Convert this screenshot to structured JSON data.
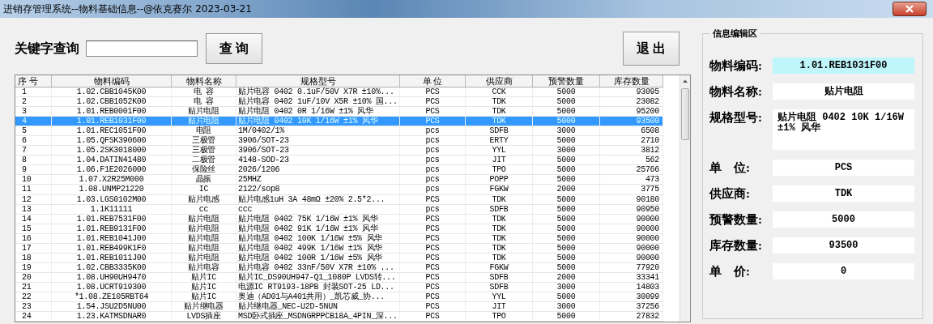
{
  "window": {
    "title": "进销存管理系统--物料基础信息--@依克赛尔 2023-03-21"
  },
  "search": {
    "label": "关键字查询",
    "button": "查 询"
  },
  "exit_button": "退 出",
  "table": {
    "columns": [
      "序 号",
      "物料编码",
      "物料名称",
      "规格型号",
      "单 位",
      "供应商",
      "预警数量",
      "库存数量"
    ],
    "rows": [
      {
        "cells": [
          "1",
          "1.02.CBB1045K00",
          "电 容",
          "贴片电容 0402 0.1uF/50V X7R ±10%...",
          "PCS",
          "CCK",
          "5000",
          "93095"
        ],
        "selected": false
      },
      {
        "cells": [
          "2",
          "1.02.CBB1052K00",
          "电 容",
          "贴片电容 0402 1uF/10V X5R ±10% 国...",
          "PCS",
          "TDK",
          "5000",
          "23082"
        ],
        "selected": false
      },
      {
        "cells": [
          "3",
          "1.01.REB0001F00",
          "贴片电阻",
          "贴片电阻 0402 0R 1/16W ±1% 风华",
          "PCS",
          "TDK",
          "5000",
          "95200"
        ],
        "selected": false
      },
      {
        "cells": [
          "4",
          "1.01.REB1031F00",
          "贴片电阻",
          "贴片电阻 0402 10K 1/16W ±1% 风华",
          "PCS",
          "TDK",
          "5000",
          "93500"
        ],
        "selected": true
      },
      {
        "cells": [
          "5",
          "1.01.REC1051F00",
          "电阻",
          "1M/0402/1%",
          "pcs",
          "SDFB",
          "3000",
          "6508"
        ],
        "selected": false
      },
      {
        "cells": [
          "6",
          "1.05.QFSK390600",
          "三极管",
          "3906/SOT-23",
          "pcs",
          "ERTY",
          "5000",
          "2710"
        ],
        "selected": false
      },
      {
        "cells": [
          "7",
          "1.05.2SK3018000",
          "三极管",
          "3906/SOT-23",
          "pcs",
          "YYL",
          "3000",
          "3812"
        ],
        "selected": false
      },
      {
        "cells": [
          "8",
          "1.04.DATIN41480",
          "二极管",
          "4148-SOD-23",
          "pcs",
          "JIT",
          "5000",
          "562"
        ],
        "selected": false
      },
      {
        "cells": [
          "9",
          "1.06.F1E2026000",
          "保险丝",
          "2026/1206",
          "pcs",
          "TPO",
          "5000",
          "25766"
        ],
        "selected": false
      },
      {
        "cells": [
          "10",
          "1.07.X2R25M000",
          "晶振",
          "25MHZ",
          "pcs",
          "POPP",
          "5000",
          "473"
        ],
        "selected": false
      },
      {
        "cells": [
          "11",
          "1.08.UNMP21220",
          "IC",
          "2122/sop8",
          "pcs",
          "FGKW",
          "2000",
          "3775"
        ],
        "selected": false
      },
      {
        "cells": [
          "12",
          "1.03.LGS0102M00",
          "贴片电感",
          "贴片电感1uH 3A 48mΩ ±20% 2.5*2...",
          "PCS",
          "TDK",
          "5000",
          "90180"
        ],
        "selected": false
      },
      {
        "cells": [
          "13",
          "1.1K11111",
          "cc",
          "ccc",
          "pcs",
          "SDFB",
          "5000",
          "90950"
        ],
        "selected": false
      },
      {
        "cells": [
          "14",
          "1.01.REB7531F00",
          "贴片电阻",
          "贴片电阻 0402 75K 1/16W ±1% 风华",
          "PCS",
          "TDK",
          "5000",
          "90000"
        ],
        "selected": false
      },
      {
        "cells": [
          "15",
          "1.01.REB9131F00",
          "贴片电阻",
          "贴片电阻 0402 91K 1/16W ±1% 风华",
          "PCS",
          "TDK",
          "5000",
          "90000"
        ],
        "selected": false
      },
      {
        "cells": [
          "16",
          "1.01.REB1041J00",
          "贴片电阻",
          "贴片电阻 0402 100K 1/16W ±5% 风华",
          "PCS",
          "TDK",
          "5000",
          "90000"
        ],
        "selected": false
      },
      {
        "cells": [
          "17",
          "1.01.REB499K1F0",
          "贴片电阻",
          "贴片电阻 0402 499K 1/16W ±1% 风华",
          "PCS",
          "TDK",
          "5000",
          "90000"
        ],
        "selected": false
      },
      {
        "cells": [
          "18",
          "1.01.REB1011J00",
          "贴片电阻",
          "贴片电阻 0402 100R 1/16W ±5% 风华",
          "PCS",
          "TDK",
          "5000",
          "90000"
        ],
        "selected": false
      },
      {
        "cells": [
          "19",
          "1.02.CBB3335K00",
          "贴片电容",
          "贴片电容 0402 33nF/50V X7R ±10% ...",
          "PCS",
          "FGKW",
          "5000",
          "77920"
        ],
        "selected": false
      },
      {
        "cells": [
          "20",
          "1.08.UH90UH9470",
          "贴片IC",
          "贴片IC_DS90UH947-Q1_1080P LVDS转...",
          "PCS",
          "SDFB",
          "2000",
          "33341"
        ],
        "selected": false
      },
      {
        "cells": [
          "21",
          "1.08.UCRT919300",
          "贴片IC",
          "电源IC RT9193-18PB 封装SOT-25 LD...",
          "PCS",
          "SDFB",
          "3000",
          "14803"
        ],
        "selected": false
      },
      {
        "cells": [
          "22",
          "*1.08.ZE105RBT64",
          "贴片IC",
          "奥迪（AD01与A401共用）_凯芯威_协...",
          "PCS",
          "YYL",
          "5000",
          "30099"
        ],
        "selected": false
      },
      {
        "cells": [
          "23",
          "1.54.JSU2D5NU00",
          "贴片继电器",
          "贴片继电器_NEC-U2D-5NUN",
          "PCS",
          "JIT",
          "3000",
          "37256"
        ],
        "selected": false
      },
      {
        "cells": [
          "24",
          "1.23.KATMSDNAR0",
          "LVDS插座",
          "MSD卧式插座_MSDNGRPPCB18A_4PIN_深...",
          "PCS",
          "TPO",
          "5000",
          "27832"
        ],
        "selected": false
      }
    ]
  },
  "editor": {
    "title": "信息编辑区",
    "fields": [
      {
        "label": "物料编码:",
        "value": "1.01.REB1031F00",
        "kind": "line",
        "focused": true
      },
      {
        "label": "物料名称:",
        "value": "贴片电阻",
        "kind": "line",
        "focused": false
      },
      {
        "label": "规格型号:",
        "value": "贴片电阻 0402 10K 1/16W ±1% 风华",
        "kind": "multiline",
        "focused": false
      },
      {
        "label": "单　位:",
        "value": "PCS",
        "kind": "line",
        "focused": false
      },
      {
        "label": "供应商:",
        "value": "TDK",
        "kind": "line",
        "focused": false
      },
      {
        "label": "预警数量:",
        "value": "5000",
        "kind": "line",
        "focused": false
      },
      {
        "label": "库存数量:",
        "value": "93500",
        "kind": "line",
        "focused": false
      },
      {
        "label": "单　价:",
        "value": "0",
        "kind": "line",
        "focused": false
      }
    ]
  }
}
